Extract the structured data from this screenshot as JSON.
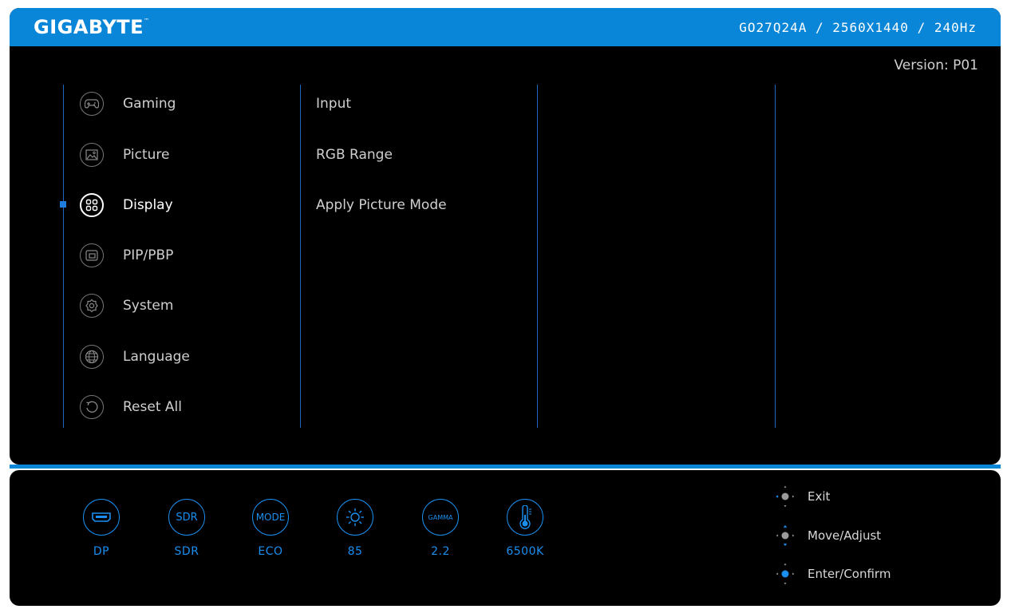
{
  "header": {
    "brand": "GIGABYTE",
    "trademark": "™",
    "model": "GO27Q24A  /  2560X1440 / 240Hz"
  },
  "version": "Version: P01",
  "menu": {
    "items": [
      {
        "label": "Gaming",
        "icon": "gamepad-icon"
      },
      {
        "label": "Picture",
        "icon": "picture-icon"
      },
      {
        "label": "Display",
        "icon": "display-grid-icon",
        "active": true
      },
      {
        "label": "PIP/PBP",
        "icon": "pip-icon"
      },
      {
        "label": "System",
        "icon": "gear-icon"
      },
      {
        "label": "Language",
        "icon": "globe-icon"
      },
      {
        "label": "Reset All",
        "icon": "reset-icon"
      }
    ]
  },
  "submenu": {
    "items": [
      "Input",
      "RGB Range",
      "Apply Picture Mode"
    ]
  },
  "status": {
    "items": [
      {
        "icon_text": "",
        "icon": "port-icon",
        "value": "DP"
      },
      {
        "icon_text": "SDR",
        "icon": "sdr-icon",
        "value": "SDR"
      },
      {
        "icon_text": "MODE",
        "icon": "mode-icon",
        "value": "ECO"
      },
      {
        "icon_text": "",
        "icon": "brightness-icon",
        "value": "85"
      },
      {
        "icon_text": "GAMMA",
        "icon": "gamma-icon",
        "value": "2.2"
      },
      {
        "icon_text": "",
        "icon": "thermometer-icon",
        "value": "6500K"
      }
    ]
  },
  "navigation": {
    "items": [
      {
        "label": "Exit",
        "icon": "joystick-left-icon"
      },
      {
        "label": "Move/Adjust",
        "icon": "joystick-updown-icon"
      },
      {
        "label": "Enter/Confirm",
        "icon": "joystick-press-icon"
      }
    ]
  },
  "colors": {
    "accent": "#0a86d8",
    "status_blue": "#1a8ff0",
    "background": "#000000"
  }
}
